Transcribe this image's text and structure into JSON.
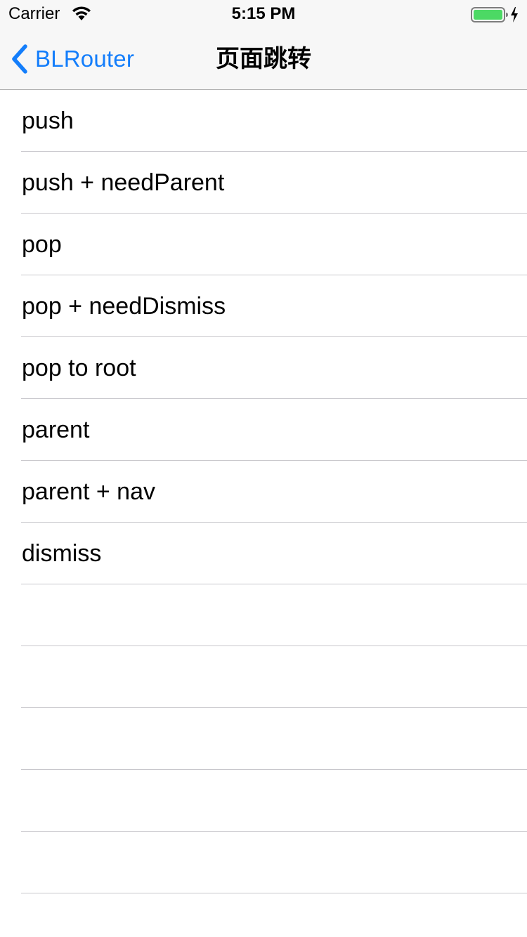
{
  "status_bar": {
    "carrier": "Carrier",
    "time": "5:15 PM",
    "battery_color": "#4cd964"
  },
  "nav_bar": {
    "back_label": "BLRouter",
    "title": "页面跳转",
    "tint_color": "#147efb"
  },
  "table": {
    "rows": [
      {
        "label": "push"
      },
      {
        "label": "push + needParent"
      },
      {
        "label": "pop"
      },
      {
        "label": "pop + needDismiss"
      },
      {
        "label": "pop to root"
      },
      {
        "label": "parent"
      },
      {
        "label": "parent + nav"
      },
      {
        "label": "dismiss"
      },
      {
        "label": ""
      },
      {
        "label": ""
      },
      {
        "label": ""
      },
      {
        "label": ""
      },
      {
        "label": ""
      },
      {
        "label": ""
      }
    ]
  }
}
